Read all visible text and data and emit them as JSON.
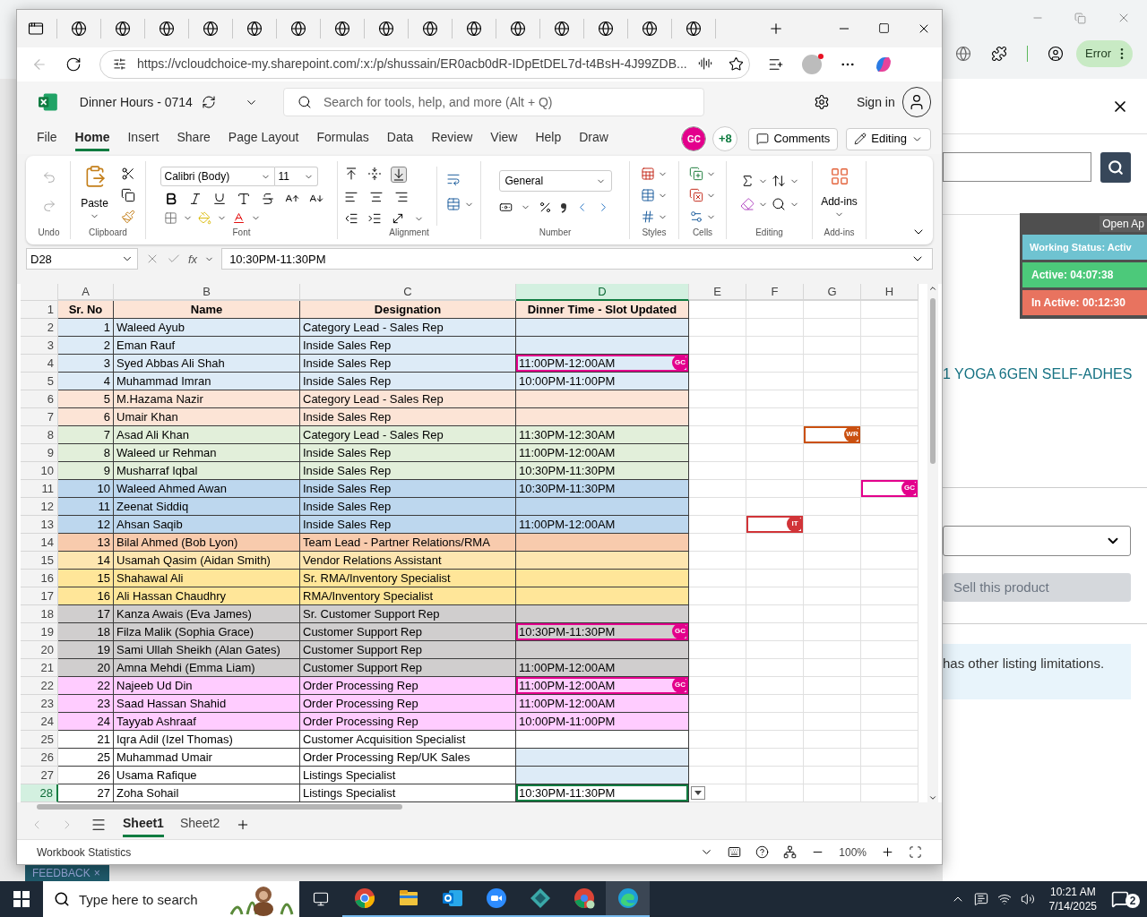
{
  "browser": {
    "url": "https://vcloudchoice-my.sharepoint.com/:x:/p/shussain/ER0acb0dR-IDpEtDEL7d-t4BsH-4J99ZDB..."
  },
  "background_browser": {
    "error_button": "Error"
  },
  "excel": {
    "file_name": "Dinner Hours - 0714",
    "search_placeholder": "Search for tools, help, and more (Alt + Q)",
    "sign_in": "Sign in",
    "menu": [
      {
        "label": "File",
        "selected": false
      },
      {
        "label": "Home",
        "selected": true
      },
      {
        "label": "Insert",
        "selected": false
      },
      {
        "label": "Share",
        "selected": false
      },
      {
        "label": "Page Layout",
        "selected": false
      },
      {
        "label": "Formulas",
        "selected": false
      },
      {
        "label": "Data",
        "selected": false
      },
      {
        "label": "Review",
        "selected": false
      },
      {
        "label": "View",
        "selected": false
      },
      {
        "label": "Help",
        "selected": false
      },
      {
        "label": "Draw",
        "selected": false
      }
    ],
    "coauthor": {
      "initials": "GC",
      "color": "#e3008c"
    },
    "more_coauthors": "+8",
    "comments": "Comments",
    "mode": "Editing",
    "ribbon": {
      "groups": [
        {
          "kind": "undo",
          "label": "Undo"
        },
        {
          "kind": "clipboard",
          "label": "Clipboard"
        },
        {
          "kind": "font",
          "label": "Font"
        },
        {
          "kind": "alignment",
          "label": "Alignment"
        },
        {
          "kind": "number",
          "label": "Number"
        },
        {
          "kind": "styles",
          "label": "Styles"
        },
        {
          "kind": "cells",
          "label": "Cells"
        },
        {
          "kind": "editing",
          "label": "Editing"
        },
        {
          "kind": "addins",
          "label": "Add-ins"
        }
      ],
      "paste": "Paste",
      "font": "Calibri (Body)",
      "size": "11",
      "number_format": "General",
      "addins": "Add-ins"
    },
    "formula_bar": {
      "name_box": "D28",
      "fx": "fx",
      "value": "10:30PM-11:30PM"
    },
    "columns": [
      {
        "label": "A",
        "selected": false
      },
      {
        "label": "B",
        "selected": false
      },
      {
        "label": "C",
        "selected": false
      },
      {
        "label": "D",
        "selected": true
      },
      {
        "label": "E",
        "selected": false
      },
      {
        "label": "F",
        "selected": false
      },
      {
        "label": "G",
        "selected": false
      },
      {
        "label": "H",
        "selected": false
      }
    ],
    "header_row": {
      "num": "1",
      "color": "#fce4d6",
      "cells": [
        "Sr. No",
        "Name",
        "Designation",
        "Dinner Time - Slot Updated"
      ]
    },
    "rows": [
      {
        "num": "2",
        "sr": "1",
        "name": "Waleed Ayub",
        "designation": "Category Lead - Sales Rep",
        "color": "#ddebf7",
        "selected": false
      },
      {
        "num": "3",
        "sr": "2",
        "name": "Eman Rauf",
        "designation": "Inside Sales Rep",
        "color": "#ddebf7",
        "selected": false
      },
      {
        "num": "4",
        "sr": "3",
        "name": "Syed Abbas Ali Shah",
        "designation": "Inside Sales Rep",
        "time": "11:00PM-12:00AM",
        "color": "#ddebf7",
        "selected": false,
        "presence": {
          "D": {
            "initials": "GC",
            "color": "#e3008c"
          }
        }
      },
      {
        "num": "5",
        "sr": "4",
        "name": "Muhammad Imran",
        "designation": "Inside Sales Rep",
        "time": "10:00PM-11:00PM",
        "color": "#ddebf7",
        "selected": false
      },
      {
        "num": "6",
        "sr": "5",
        "name": "M.Hazama Nazir",
        "designation": "Category Lead - Sales Rep",
        "color": "#fce4d6",
        "selected": false
      },
      {
        "num": "7",
        "sr": "6",
        "name": "Umair Khan",
        "designation": "Inside Sales Rep",
        "color": "#fce4d6",
        "selected": false
      },
      {
        "num": "8",
        "sr": "7",
        "name": "Asad Ali Khan",
        "designation": "Category Lead - Sales Rep",
        "time": "11:30PM-12:30AM",
        "color": "#e2efda",
        "selected": false,
        "presence": {
          "G": {
            "initials": "WR",
            "color": "#ca5010"
          }
        }
      },
      {
        "num": "9",
        "sr": "8",
        "name": "Waleed ur Rehman",
        "designation": "Inside Sales Rep",
        "time": "11:00PM-12:00AM",
        "color": "#e2efda",
        "selected": false
      },
      {
        "num": "10",
        "sr": "9",
        "name": "Musharraf Iqbal",
        "designation": "Inside Sales Rep",
        "time": "10:30PM-11:30PM",
        "color": "#e2efda",
        "selected": false
      },
      {
        "num": "11",
        "sr": "10",
        "name": "Waleed Ahmed Awan",
        "designation": "Inside Sales Rep",
        "time": "10:30PM-11:30PM",
        "color": "#bdd7ee",
        "selected": false,
        "presence": {
          "H": {
            "initials": "GC",
            "color": "#e3008c"
          }
        }
      },
      {
        "num": "12",
        "sr": "11",
        "name": "Zeenat Siddiq",
        "designation": "Inside Sales Rep",
        "color": "#bdd7ee",
        "selected": false
      },
      {
        "num": "13",
        "sr": "12",
        "name": "Ahsan Saqib",
        "designation": "Inside Sales Rep",
        "time": "11:00PM-12:00AM",
        "color": "#bdd7ee",
        "selected": false,
        "presence": {
          "F": {
            "initials": "IT",
            "color": "#d13438"
          }
        }
      },
      {
        "num": "14",
        "sr": "13",
        "name": "Bilal Ahmed (Bob Lyon)",
        "designation": "Team Lead - Partner Relations/RMA",
        "color": "#f8cbad",
        "selected": false
      },
      {
        "num": "15",
        "sr": "14",
        "name": "Usamah Qasim (Aidan Smith)",
        "designation": "Vendor Relations Assistant",
        "color": "#fde6b0",
        "selected": false
      },
      {
        "num": "16",
        "sr": "15",
        "name": "Shahawal Ali",
        "designation": "Sr. RMA/Inventory Specialist",
        "color": "#ffe699",
        "selected": false
      },
      {
        "num": "17",
        "sr": "16",
        "name": "Ali Hassan Chaudhry",
        "designation": "RMA/Inventory Specialist",
        "color": "#ffe699",
        "selected": false
      },
      {
        "num": "18",
        "sr": "17",
        "name": "Kanza Awais (Eva James)",
        "designation": "Sr. Customer Support Rep",
        "color": "#d0cece",
        "selected": false
      },
      {
        "num": "19",
        "sr": "18",
        "name": "Filza Malik (Sophia Grace)",
        "designation": "Customer Support Rep",
        "time": "10:30PM-11:30PM",
        "color": "#d0cece",
        "selected": false,
        "presence": {
          "D": {
            "initials": "GC",
            "color": "#e3008c"
          }
        }
      },
      {
        "num": "20",
        "sr": "19",
        "name": "Sami Ullah Sheikh (Alan Gates)",
        "designation": "Customer Support Rep",
        "color": "#d0cece",
        "selected": false
      },
      {
        "num": "21",
        "sr": "20",
        "name": "Amna Mehdi (Emma Liam)",
        "designation": "Customer Support Rep",
        "time": "11:00PM-12:00AM",
        "color": "#d0cece",
        "selected": false
      },
      {
        "num": "22",
        "sr": "22",
        "name": "Najeeb Ud Din",
        "designation": "Order Processing Rep",
        "time": "11:00PM-12:00AM",
        "color": "#ffccff",
        "selected": false,
        "presence": {
          "D": {
            "initials": "GC",
            "color": "#e3008c"
          }
        }
      },
      {
        "num": "23",
        "sr": "23",
        "name": "Saad Hassan Shahid",
        "designation": "Order Processing Rep",
        "time": "11:00PM-12:00AM",
        "color": "#ffccff",
        "selected": false
      },
      {
        "num": "24",
        "sr": "24",
        "name": "Tayyab Ashraaf",
        "designation": "Order Processing Rep",
        "time": "10:00PM-11:00PM",
        "color": "#ffccff",
        "selected": false
      },
      {
        "num": "25",
        "sr": "21",
        "name": "Iqra Adil (Izel Thomas)",
        "designation": "Customer Acquisition Specialist",
        "color": "#ffffff",
        "selected": false
      },
      {
        "num": "26",
        "sr": "25",
        "name": "Muhammad Umair",
        "designation": "Order Processing Rep/UK Sales",
        "color": "#ffffff",
        "time_cell": {
          "color": "#ddebf7"
        },
        "selected": false
      },
      {
        "num": "27",
        "sr": "26",
        "name": "Usama Rafique",
        "designation": "Listings Specialist",
        "color": "#ffffff",
        "time_cell": {
          "color": "#ddebf7"
        },
        "selected": false
      },
      {
        "num": "28",
        "sr": "27",
        "name": "Zoha Sohail",
        "designation": "Listings Specialist",
        "time": "10:30PM-11:30PM",
        "color": "#ffffff",
        "selected": true
      }
    ],
    "sheets": [
      {
        "label": "Sheet1",
        "selected": true
      },
      {
        "label": "Sheet2",
        "selected": false
      }
    ],
    "status": {
      "left": "Workbook Statistics",
      "zoom": "100%"
    }
  },
  "side_panel": {
    "widget_tab": "Open Ap",
    "working_status": "Working Status: Activ",
    "active": "Active: 04:07:38",
    "inactive": "In Active: 00:12:30",
    "product_link": "1 YOGA 6GEN SELF-ADHES",
    "sell_button": "Sell this product",
    "notice": "has other listing limitations."
  },
  "feedback": {
    "label": "FEEDBACK",
    "close": "×"
  },
  "taskbar": {
    "search_placeholder": "Type here to search",
    "time": "10:21 AM",
    "date": "7/14/2025",
    "notifications": "2"
  }
}
